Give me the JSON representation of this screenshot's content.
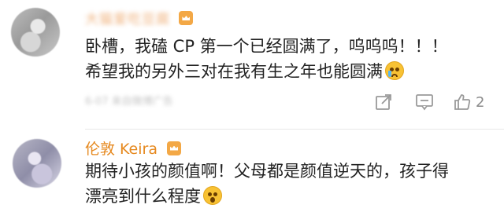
{
  "comments": [
    {
      "username": "大猫爱吃豆腐",
      "badge_icon": "vip-crown-icon",
      "lines": [
        "卧槽，我磕 CP 第一个已经圆满了，呜呜呜！！！",
        "希望我的另外三对在我有生之年也能圆满"
      ],
      "line2_emoji": "crying-face-icon",
      "meta": "6-07 来自微博广告",
      "actions": {
        "share_icon": "share-icon",
        "comment_icon": "comment-icon",
        "like_icon": "thumbs-up-icon",
        "like_count": "2"
      }
    },
    {
      "username": "伦敦 Keira",
      "badge_icon": "vip-crown-icon",
      "lines": [
        "期待小孩的颜值啊！父母都是颜值逆天的，孩子得",
        "漂亮到什么程度"
      ],
      "line2_emoji": "screaming-face-icon"
    }
  ],
  "colors": {
    "username": "#e6891f",
    "text": "#222222",
    "icon": "#9a9a9a",
    "divider": "#e8e8e8"
  }
}
